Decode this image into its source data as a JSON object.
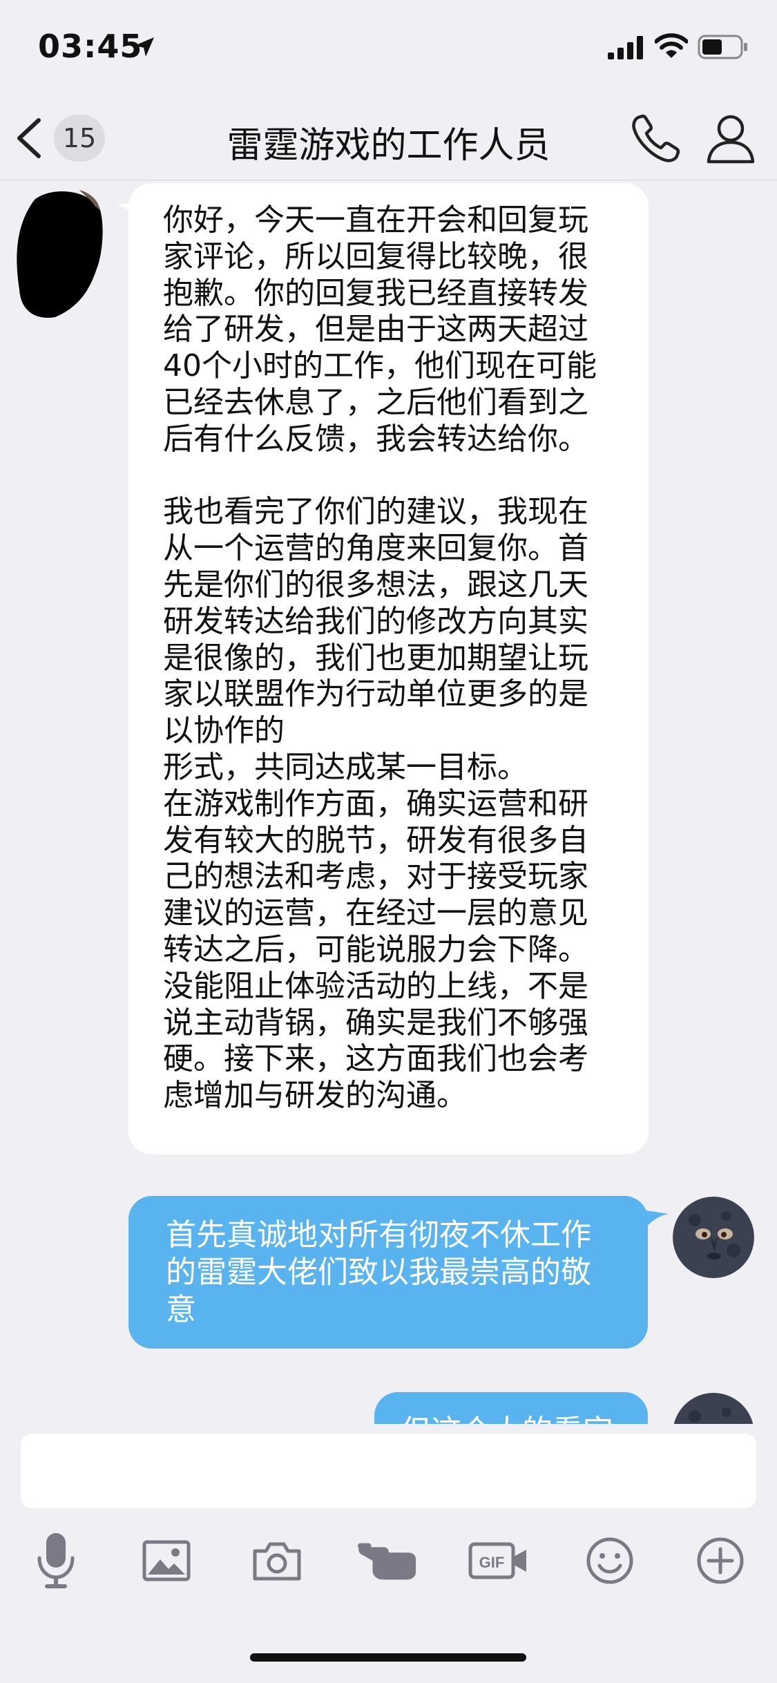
{
  "status_bar": {
    "time": "03:45",
    "icons": [
      "location-arrow-icon",
      "signal-icon",
      "wifi-icon",
      "battery-icon"
    ]
  },
  "nav": {
    "unread_count": "15",
    "title": "雷霆游戏的工作人员",
    "icons": [
      "back-chevron-icon",
      "phone-icon",
      "profile-icon"
    ]
  },
  "messages": [
    {
      "direction": "incoming",
      "text": "你好，今天一直在开会和回复玩\n家评论，所以回复得比较晚，很\n抱歉。你的回复我已经直接转发\n给了研发，但是由于这两天超过\n40个小时的工作，他们现在可能\n已经去休息了，之后他们看到之\n后有什么反馈，我会转达给你。\n\n我也看完了你们的建议，我现在\n从一个运营的角度来回复你。首\n先是你们的很多想法，跟这几天\n研发转达给我们的修改方向其实\n是很像的，我们也更加期望让玩\n家以联盟作为行动单位更多的是\n以协作的\n形式，共同达成某一目标。\n在游戏制作方面，确实运营和研\n发有较大的脱节，研发有很多自\n己的想法和考虑，对于接受玩家\n建议的运营，在经过一层的意见\n转达之后，可能说服力会下降。\n没能阻止体验活动的上线，不是\n说主动背锅，确实是我们不够强\n硬。接下来，这方面我们也会考\n虑增加与研发的沟通。"
    },
    {
      "direction": "outgoing",
      "text": "首先真诚地对所有彻夜不休工作\n的雷霆大佬们致以我最崇高的敬\n意"
    },
    {
      "direction": "outgoing",
      "text": "但这个大的看完"
    }
  ],
  "input": {
    "placeholder": ""
  },
  "toolbar": [
    "microphone-icon",
    "image-icon",
    "camera-icon",
    "poke-hand-icon",
    "gif-icon",
    "emoji-icon",
    "add-icon"
  ],
  "colors": {
    "background": "#efeff4",
    "outgoing_bubble": "#58b3ee",
    "incoming_bubble": "#ffffff",
    "icon_gray": "#7a7a86"
  }
}
